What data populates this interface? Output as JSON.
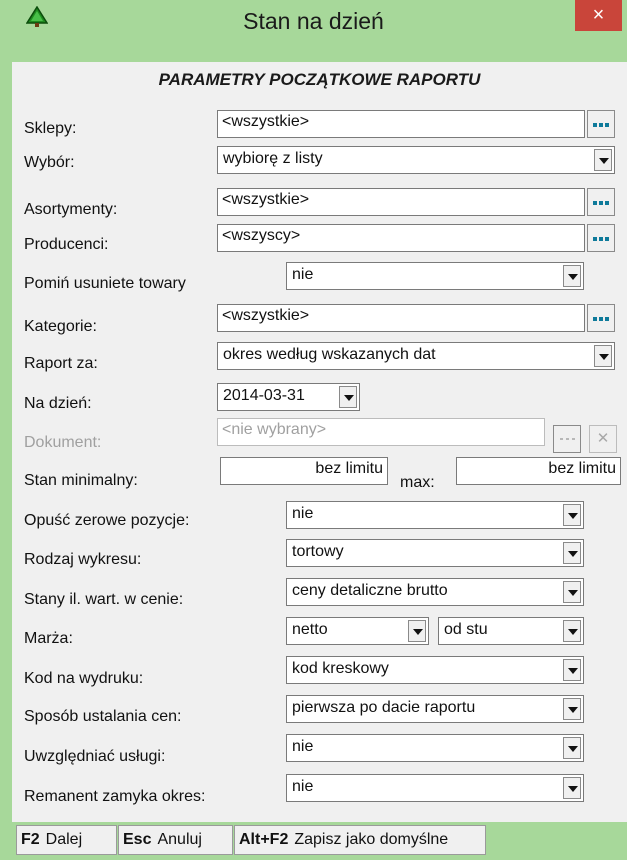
{
  "window": {
    "title": "Stan na dzień",
    "close_label": "×"
  },
  "heading": "PARAMETRY POCZĄTKOWE RAPORTU",
  "rows": {
    "sklepy": {
      "label": "Sklepy:",
      "value": "<wszystkie>"
    },
    "wybor": {
      "label": "Wybór:",
      "value": "wybiorę z listy"
    },
    "asortymenty": {
      "label": "Asortymenty:",
      "value": "<wszystkie>"
    },
    "producenci": {
      "label": "Producenci:",
      "value": "<wszyscy>"
    },
    "pomin": {
      "label": "Pomiń usuniete towary",
      "value": "nie"
    },
    "kategorie": {
      "label": "Kategorie:",
      "value": "<wszystkie>"
    },
    "raport_za": {
      "label": "Raport za:",
      "value": "okres według wskazanych dat"
    },
    "na_dzien": {
      "label": "Na dzień:",
      "value": "2014-03-31"
    },
    "dokument": {
      "label": "Dokument:",
      "value": "<nie wybrany>"
    },
    "stan_min": {
      "label": "Stan minimalny:",
      "value": "bez limitu",
      "max_label": "max:",
      "max_value": "bez limitu"
    },
    "opusc": {
      "label": "Opuść zerowe pozycje:",
      "value": "nie"
    },
    "wykres": {
      "label": "Rodzaj wykresu:",
      "value": "tortowy"
    },
    "stany": {
      "label": "Stany il. wart. w cenie:",
      "value": "ceny detaliczne brutto"
    },
    "marza": {
      "label": "Marża:",
      "value": "netto",
      "value2": "od stu"
    },
    "kod": {
      "label": "Kod na wydruku:",
      "value": "kod kreskowy"
    },
    "sposob": {
      "label": "Sposób ustalania cen:",
      "value": "pierwsza po dacie raportu"
    },
    "uslugi": {
      "label": "Uwzględniać usługi:",
      "value": "nie"
    },
    "remanent": {
      "label": "Remanent zamyka okres:",
      "value": "nie"
    }
  },
  "footer": [
    {
      "key": "F2",
      "label": "Dalej"
    },
    {
      "key": "Esc",
      "label": "Anuluj"
    },
    {
      "key": "Alt+F2",
      "label": "Zapisz jako domyślne"
    }
  ],
  "icons": {
    "app": "green-tree-icon",
    "more": "ellipsis-icon",
    "clear": "clear-icon",
    "dropdown": "chevron-down-icon"
  },
  "colors": {
    "frame": "#a7d89a",
    "close": "#c9453a",
    "panel": "#f0f0f0",
    "dots": "#0e7a9a"
  }
}
